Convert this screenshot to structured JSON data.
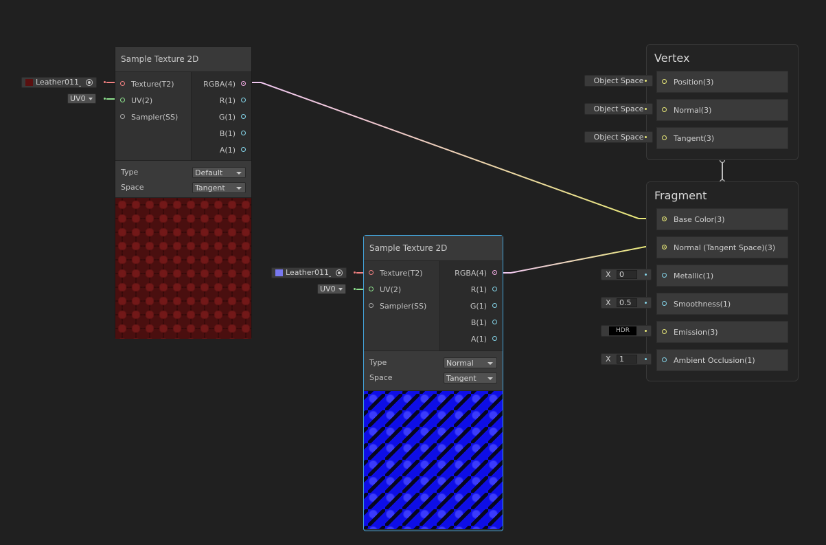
{
  "node_top": {
    "title": "Sample Texture 2D",
    "inputs": [
      "Texture(T2)",
      "UV(2)",
      "Sampler(SS)"
    ],
    "outputs": [
      "RGBA(4)",
      "R(1)",
      "G(1)",
      "B(1)",
      "A(1)"
    ],
    "type_label": "Type",
    "type_value": "Default",
    "space_label": "Space",
    "space_value": "Tangent",
    "texture_field": "Leather011_:",
    "uv_value": "UV0"
  },
  "node_bottom": {
    "title": "Sample Texture 2D",
    "inputs": [
      "Texture(T2)",
      "UV(2)",
      "Sampler(SS)"
    ],
    "outputs": [
      "RGBA(4)",
      "R(1)",
      "G(1)",
      "B(1)",
      "A(1)"
    ],
    "type_label": "Type",
    "type_value": "Normal",
    "space_label": "Space",
    "space_value": "Tangent",
    "texture_field": "Leather011_:",
    "uv_value": "UV0"
  },
  "vertex": {
    "title": "Vertex",
    "blocks": [
      "Position(3)",
      "Normal(3)",
      "Tangent(3)"
    ],
    "space_fields": [
      "Object Space",
      "Object Space",
      "Object Space"
    ]
  },
  "fragment": {
    "title": "Fragment",
    "blocks": [
      "Base Color(3)",
      "Normal (Tangent Space)(3)",
      "Metallic(1)",
      "Smoothness(1)",
      "Emission(3)",
      "Ambient Occlusion(1)"
    ],
    "metallic_value": "0",
    "smoothness_value": "0.5",
    "emission_label": "HDR",
    "occlusion_value": "1",
    "x_label": "X"
  },
  "colors": {
    "background": "#202020",
    "selection": "#44a8e0",
    "wire_color_in": "#e8e878",
    "wire_color_out": "#f0c8f0"
  }
}
